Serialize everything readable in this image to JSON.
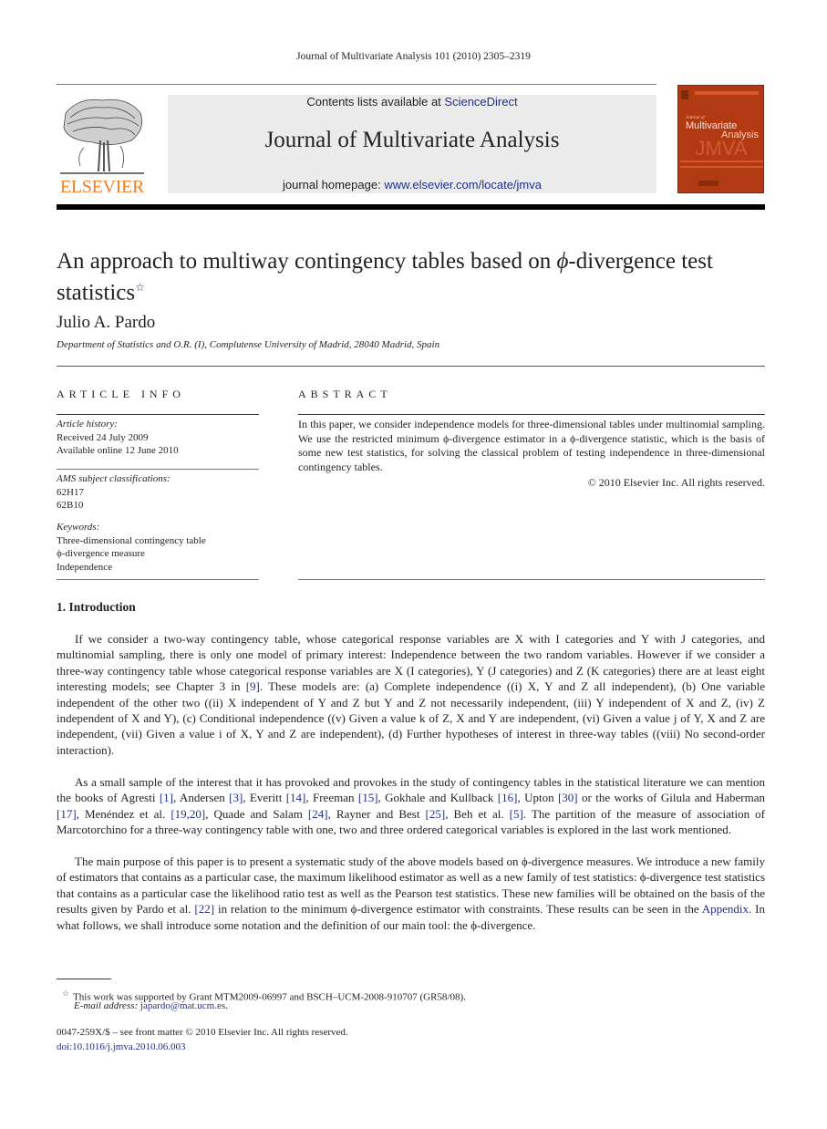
{
  "running_head": "Journal of Multivariate Analysis 101 (2010) 2305–2319",
  "masthead": {
    "publisher_logo_text": "ELSEVIER",
    "contents_prefix": "Contents lists available at ",
    "contents_link": "ScienceDirect",
    "journal_name": "Journal of Multivariate Analysis",
    "homepage_prefix": "journal homepage: ",
    "homepage_link": "www.elsevier.com/locate/jmva",
    "cover": {
      "small_title": "Journal of",
      "title_line1": "Multivariate",
      "title_line2": "Analysis",
      "acronym": "JMVA",
      "color": "#b23a12"
    },
    "logo_color": "#f07e26"
  },
  "article": {
    "title_part1": "An approach to multiway contingency tables based on ",
    "title_phi": "ϕ",
    "title_part2": "-divergence test statistics",
    "title_marker": "☆",
    "author": "Julio A. Pardo",
    "affiliation": "Department of Statistics and O.R. (I), Complutense University of Madrid, 28040 Madrid, Spain"
  },
  "article_info": {
    "heading": "ARTICLE INFO",
    "history_label": "Article history:",
    "received": "Received 24 July 2009",
    "available": "Available online 12 June 2010",
    "ams_label": "AMS subject classifications:",
    "ams_codes": [
      "62H17",
      "62B10"
    ],
    "keywords_label": "Keywords:",
    "keywords": [
      "Three-dimensional contingency table",
      "ϕ-divergence measure",
      "Independence"
    ]
  },
  "abstract": {
    "heading": "ABSTRACT",
    "text": "In this paper, we consider independence models for three-dimensional tables under multinomial sampling. We use the restricted minimum ϕ-divergence estimator in a ϕ-divergence statistic, which is the basis of some new test statistics, for solving the classical problem of testing independence in three-dimensional contingency tables.",
    "copyright": "© 2010 Elsevier Inc. All rights reserved."
  },
  "introduction": {
    "heading": "1.  Introduction",
    "paragraph1": "If we consider a two-way contingency table, whose categorical response variables are X with I categories and Y with J categories, and multinomial sampling, there is only one model of primary interest: Independence between the two random variables. However if we consider a three-way contingency table whose categorical response variables are X (I categories), Y (J categories) and Z (K categories) there are at least eight interesting models; see Chapter 3 in [9]. These models are: (a) Complete independence ((i) X, Y and Z all independent), (b) One variable independent of the other two ((ii) X independent of Y and Z but Y and Z not necessarily independent, (iii) Y independent of X and Z, (iv) Z independent of X and Y), (c) Conditional independence ((v) Given a value k of Z, X and Y are independent, (vi) Given a value j of Y, X and Z are independent, (vii) Given a value i of X, Y and Z are independent), (d) Further hypotheses of interest in three-way tables ((viii) No second-order interaction).",
    "paragraph2": "As a small sample of the interest that it has provoked and provokes in the study of contingency tables in the statistical literature we can mention the books of Agresti [1], Andersen [3], Everitt [14], Freeman [15], Gokhale and Kullback [16], Upton [30] or the works of Gilula and Haberman [17], Menéndez et al. [19,20], Quade and Salam [24], Rayner and Best [25], Beh et al. [5]. The partition of the measure of association of Marcotorchino for a three-way contingency table with one, two and three ordered categorical variables is explored in the last work mentioned.",
    "paragraph3": "The main purpose of this paper is to present a systematic study of the above models based on ϕ-divergence measures. We introduce a new family of estimators that contains as a particular case, the maximum likelihood estimator as well as a new family of test statistics: ϕ-divergence test statistics that contains as a particular case the likelihood ratio test as well as the Pearson test statistics. These new families will be obtained on the basis of the results given by Pardo et al. [22] in relation to the minimum ϕ-divergence estimator with constraints. These results can be seen in the Appendix. In what follows, we shall introduce some notation and the definition of our main tool: the ϕ-divergence.",
    "citation_links": [
      "[9]",
      "[1]",
      "[3]",
      "[14]",
      "[15]",
      "[16]",
      "[30]",
      "[17]",
      "[19,20]",
      "[24]",
      "[25]",
      "[5]",
      "[22]",
      "Appendix"
    ]
  },
  "footnotes": {
    "marker": "☆",
    "funding": "This work was supported by Grant MTM2009-06997 and BSCH–UCM-2008-910707 (GR58/08).",
    "email_label": "E-mail address: ",
    "email": "japardo@mat.ucm.es",
    "email_suffix": "."
  },
  "front_matter": {
    "issn_line": "0047-259X/$ – see front matter © 2010 Elsevier Inc. All rights reserved.",
    "doi": "doi:10.1016/j.jmva.2010.06.003"
  }
}
